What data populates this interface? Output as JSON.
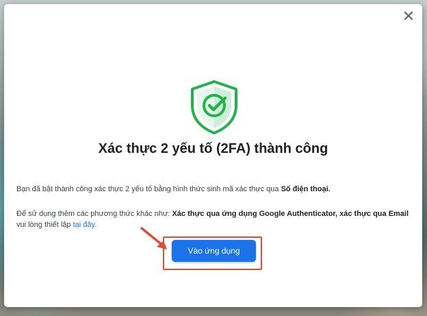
{
  "dialog": {
    "close_glyph": "✕",
    "title": "Xác thực 2 yếu tố (2FA) thành công",
    "para1_text": "Bạn đã bật thành công xác thực 2 yếu tố bằng hình thức sinh mã xác thực qua ",
    "para1_bold": "Số điện thoại.",
    "para2_text": "Để sử dụng thêm các phương thức khác như: ",
    "para2_bold": "Xác thực qua ứng dụng Google Authenticator, xác thực qua Email",
    "para2_tail": " vui lòng thiết lập ",
    "para2_link": "tại đây.",
    "button_label": "Vào ứng dụng"
  },
  "colors": {
    "shield_green": "#22b24c",
    "accent_blue": "#1a73e8",
    "highlight_red": "#e04b3c"
  }
}
